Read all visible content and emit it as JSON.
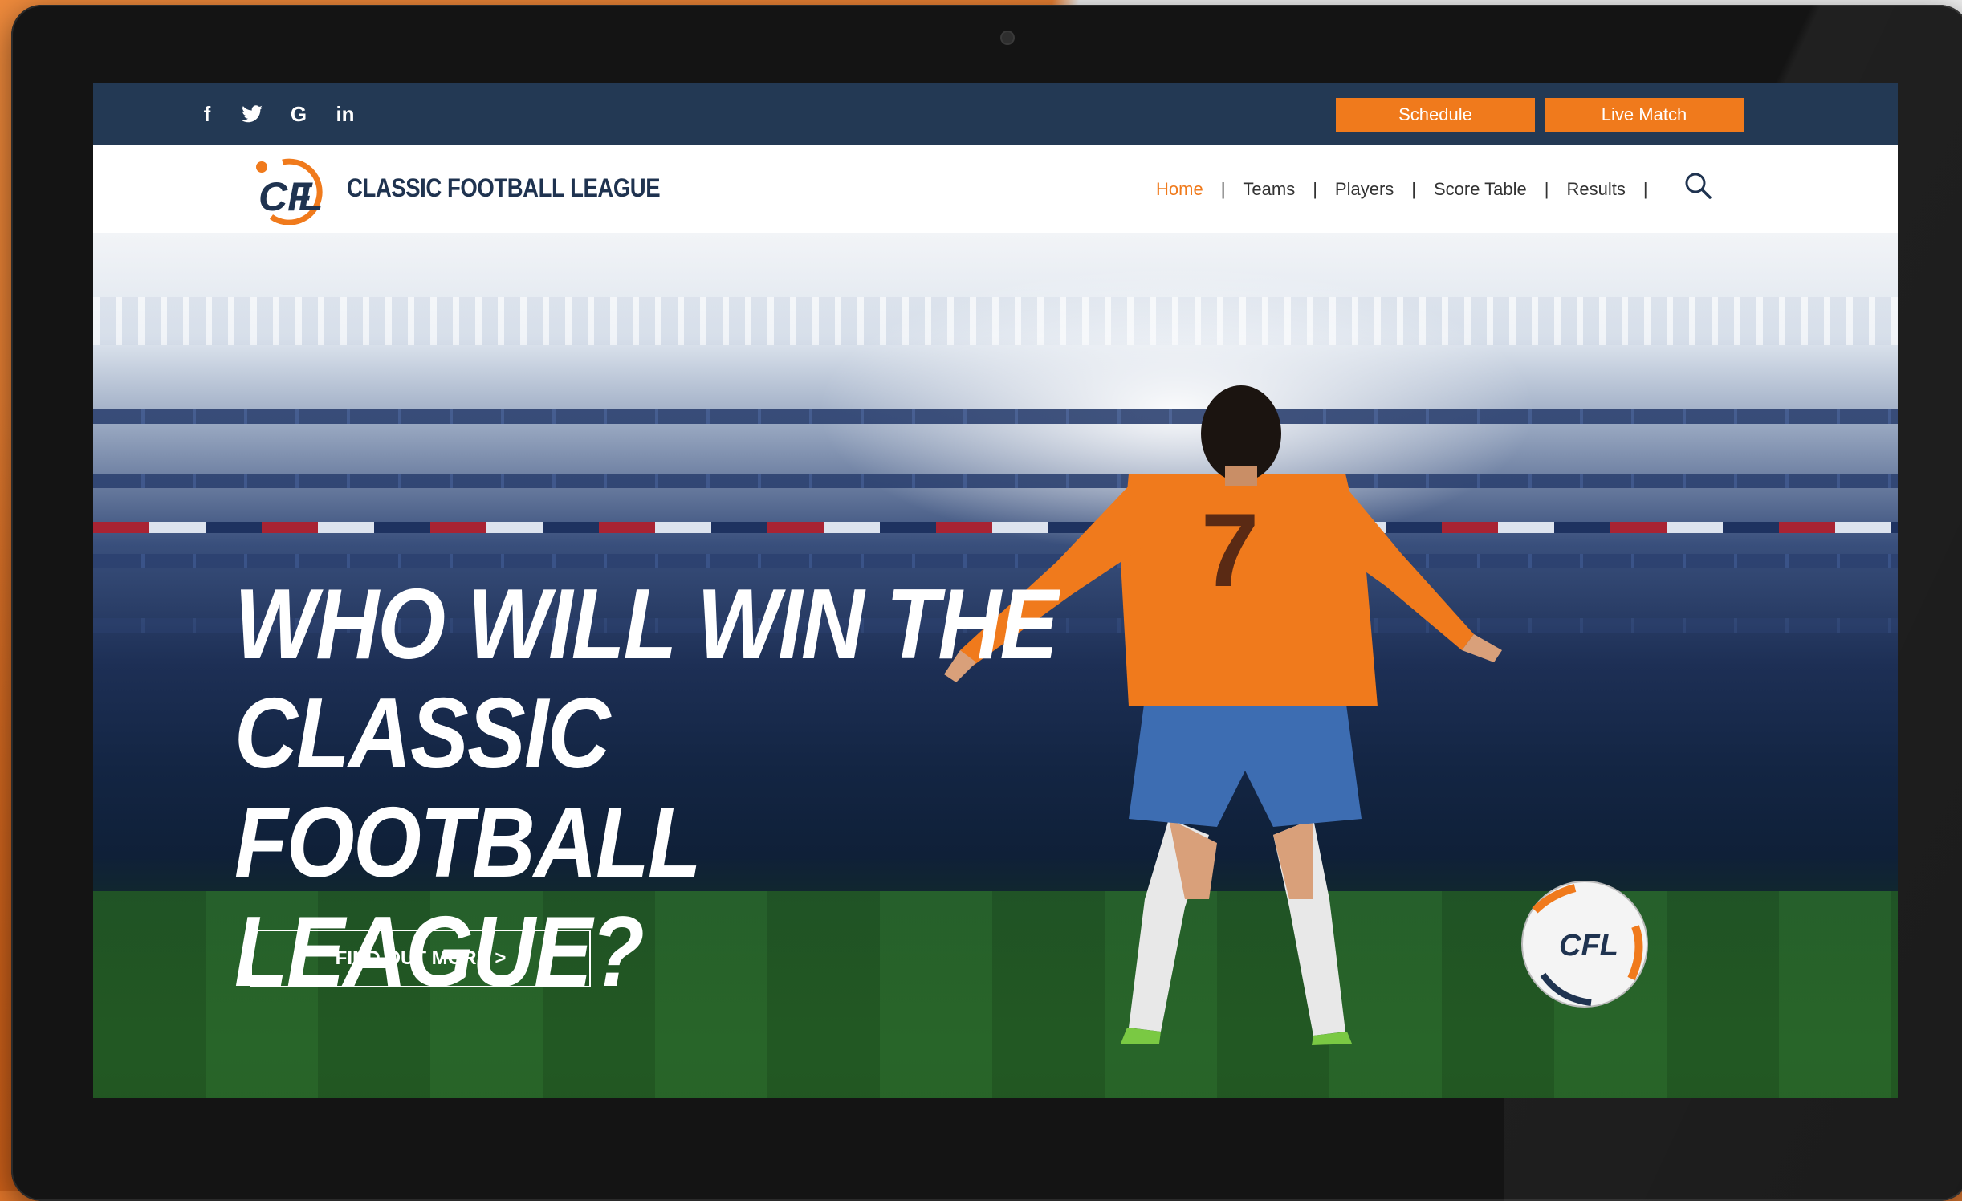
{
  "topbar": {
    "social": [
      {
        "icon": "facebook-icon",
        "glyph": "f"
      },
      {
        "icon": "twitter-icon",
        "glyph": "🐦"
      },
      {
        "icon": "google-icon",
        "glyph": "G"
      },
      {
        "icon": "linkedin-icon",
        "glyph": "in"
      }
    ],
    "schedule_label": "Schedule",
    "live_match_label": "Live Match"
  },
  "brand": {
    "logo_initials": "CFL",
    "name": "CLASSIC FOOTBALL LEAGUE"
  },
  "nav": {
    "items": [
      {
        "label": "Home",
        "active": true
      },
      {
        "label": "Teams"
      },
      {
        "label": "Players"
      },
      {
        "label": "Score Table"
      },
      {
        "label": "Results"
      }
    ],
    "separator": "|",
    "search_icon": "search-icon"
  },
  "hero": {
    "title_lines": [
      "WHO WILL WIN THE",
      "CLASSIC FOOTBALL",
      "LEAGUE?"
    ],
    "cta_label": "FIND OUT MORE >",
    "jersey_number": "7",
    "ball_logo": "CFL"
  },
  "colors": {
    "accent": "#f07a1c",
    "topbar": "#233954",
    "brand_text": "#1f3350"
  }
}
